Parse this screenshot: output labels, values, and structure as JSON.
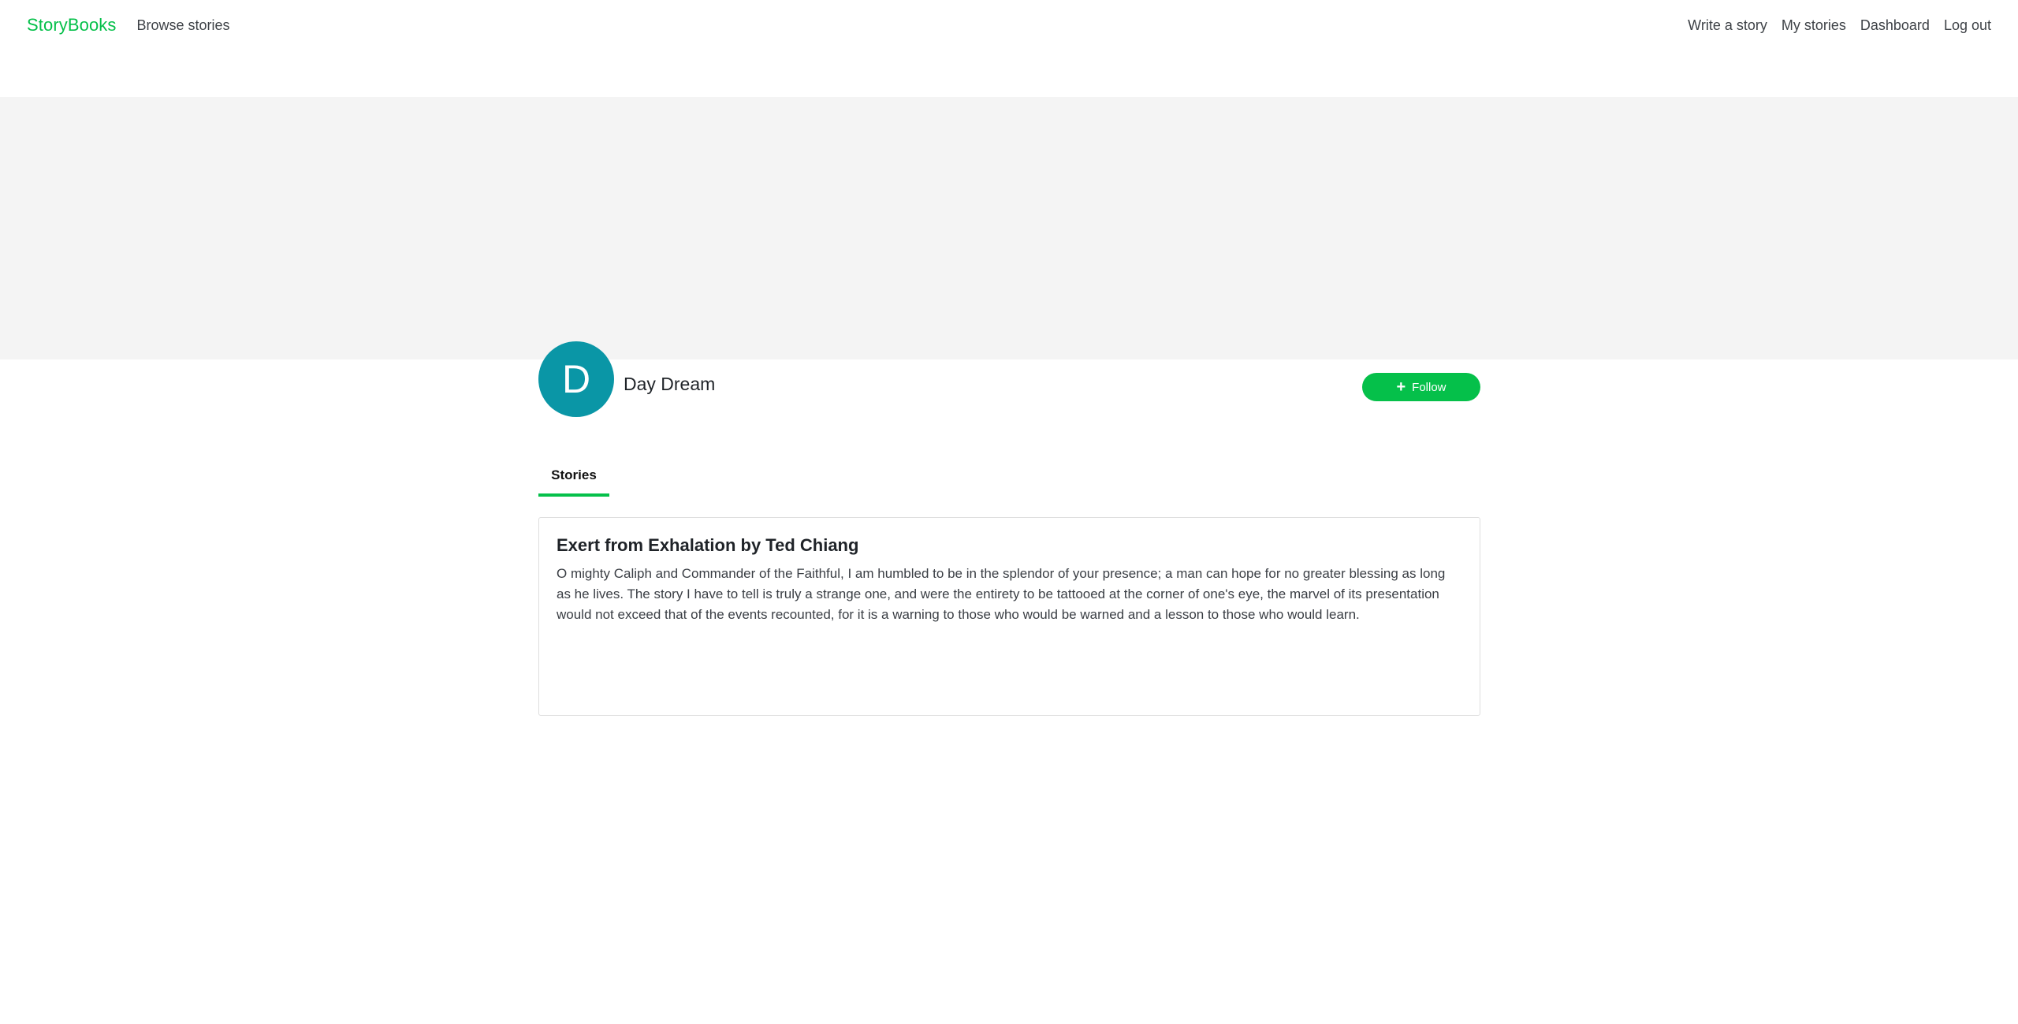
{
  "nav": {
    "brand": "StoryBooks",
    "browse": "Browse stories",
    "right_links": [
      "Write a story",
      "My stories",
      "Dashboard",
      "Log out"
    ]
  },
  "profile": {
    "initial": "D",
    "name": "Day Dream",
    "avatar_color": "#0a96a6",
    "follow_label": "Follow"
  },
  "tabs": {
    "stories_label": "Stories"
  },
  "stories": [
    {
      "title": "Exert from Exhalation by Ted Chiang",
      "excerpt": "O mighty Caliph and Commander of the Faithful, I am humbled to be in the splendor of your presence; a man can hope for no greater blessing as long as he lives. The story I have to tell is truly a strange one, and were the entirety to be tattooed at the corner of one's eye, the marvel of its presentation would not exceed that of the events recounted, for it is a warning to those who would be warned and a lesson to those who would learn."
    }
  ],
  "colors": {
    "accent": "#05c04a",
    "cover_bg": "#f4f4f4"
  },
  "icons": {
    "follow": "plus-icon"
  }
}
